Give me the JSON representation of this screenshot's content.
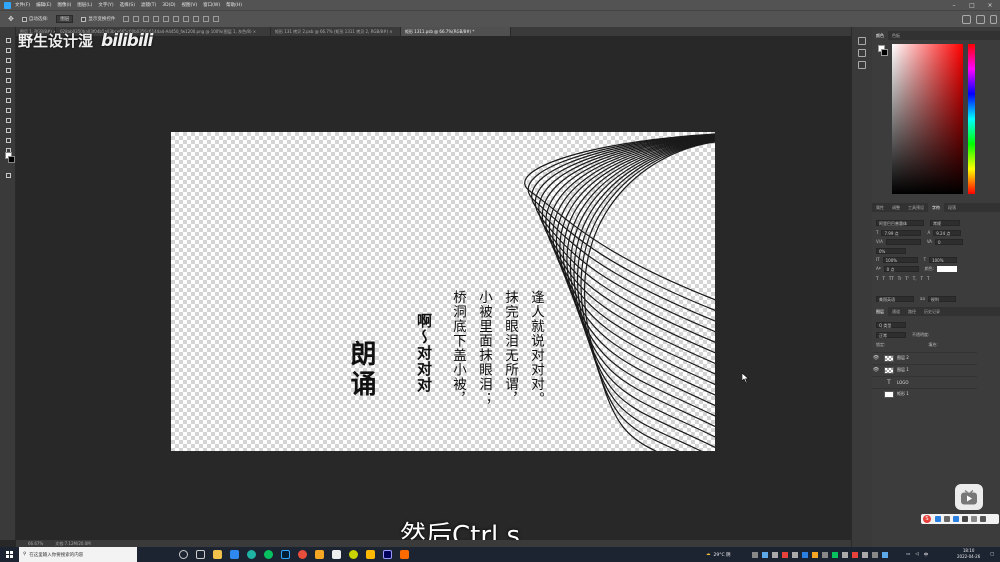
{
  "menubar": {
    "items": [
      "文件(F)",
      "编辑(E)",
      "图像(I)",
      "图层(L)",
      "文字(Y)",
      "选择(S)",
      "滤镜(T)",
      "3D(D)",
      "视图(V)",
      "窗口(W)",
      "帮助(H)"
    ]
  },
  "options": {
    "auto_select": "自动选择:",
    "auto_select_target": "图层",
    "show_transform": "显示变换控件"
  },
  "tabs": [
    {
      "label": "图层 1, RGB/8#) ×",
      "active": false
    },
    {
      "label": "028ab0350ba03f04b5a03bce665c00b0356c6144a4-A4450_fw1200.png @ 100%(图层 1, 灰色/8) ×",
      "active": false
    },
    {
      "label": "矩形 131 拷贝 2.psb @ 66.7% (矩形 1311 拷贝 2, RGB/8#) ×",
      "active": false
    },
    {
      "label": "矩形 1311.psb @ 66.7%(RGB/8#) *",
      "active": true
    }
  ],
  "watermark": {
    "name": "野生设计湿",
    "logo": "bilibili"
  },
  "artwork": {
    "title": "朗诵",
    "subtitle_line": "啊～对对对",
    "poem_lines": [
      "桥洞底下盖小被，",
      "小被里面抹眼泪；",
      "抹完眼泪无所谓，",
      "逢人就说对对对。"
    ]
  },
  "video_subtitle": "然后Ctrl s",
  "statusbar": {
    "zoom": "66.67%",
    "doc_info": "文档:7.12M/20.0M"
  },
  "color_panel": {
    "tabs": [
      "颜色",
      "色板"
    ]
  },
  "character_panel": {
    "tabs": [
      "属性",
      "调整",
      "工具预设",
      "字符",
      "段落"
    ],
    "font_family": "阿里巴巴普惠体",
    "font_style": "常规",
    "font_size": "7.99 点",
    "leading": "9.24 点",
    "tracking_label": "V/A",
    "tracking": "0",
    "scale_label": "0%",
    "vertical_scale": "100%",
    "horizontal_scale": "100%",
    "baseline": "0 点",
    "color_label": "颜色:",
    "text_buttons": [
      "T",
      "T",
      "TT",
      "Tr",
      "T'",
      "T,",
      "T",
      "T"
    ],
    "aa_language": "美国英语",
    "aa_mode": "锐利"
  },
  "layers_panel": {
    "tabs": [
      "图层",
      "通道",
      "路径",
      "历史记录"
    ],
    "filter_label": "Q 类型",
    "mode": "正常",
    "opacity_label": "不透明度:",
    "lock_label": "锁定:",
    "fill_label": "填充:",
    "layers": [
      {
        "name": "图层 2",
        "type": "raster",
        "visible": true
      },
      {
        "name": "图层 1",
        "type": "raster",
        "visible": true
      },
      {
        "name": "LOGO",
        "type": "text",
        "visible": false
      },
      {
        "name": "矩形 1",
        "type": "shape",
        "visible": false
      }
    ]
  },
  "taskbar": {
    "search_placeholder": "在这里输入你要搜索的内容",
    "weather": "29°C 阴",
    "ime": "中",
    "time": "18:10",
    "date": "2022-04-26"
  },
  "colors": {
    "ps_blue": "#31a8ff",
    "workspace": "#282828",
    "panel": "#3c3c3c"
  }
}
